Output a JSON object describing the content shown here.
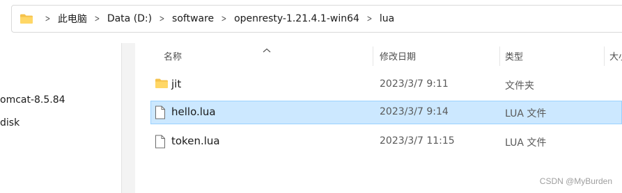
{
  "breadcrumb": [
    "此电脑",
    "Data (D:)",
    "software",
    "openresty-1.21.4.1-win64",
    "lua"
  ],
  "nav": [
    "omcat-8.5.84",
    "disk"
  ],
  "columns": {
    "name": "名称",
    "modified": "修改日期",
    "type": "类型",
    "size": "大小"
  },
  "files": [
    {
      "name": "jit",
      "modified": "2023/3/7 9:11",
      "type": "文件夹",
      "icon": "folder-icon",
      "selected": false
    },
    {
      "name": "hello.lua",
      "modified": "2023/3/7 9:14",
      "type": "LUA 文件",
      "icon": "file-icon",
      "selected": true
    },
    {
      "name": "token.lua",
      "modified": "2023/3/7 11:15",
      "type": "LUA 文件",
      "icon": "file-icon",
      "selected": false
    }
  ],
  "watermark": "CSDN @MyBurden",
  "colors": {
    "selection_bg": "#cce8ff",
    "selection_border": "#99d1ff",
    "folder": "#f5c24b"
  }
}
